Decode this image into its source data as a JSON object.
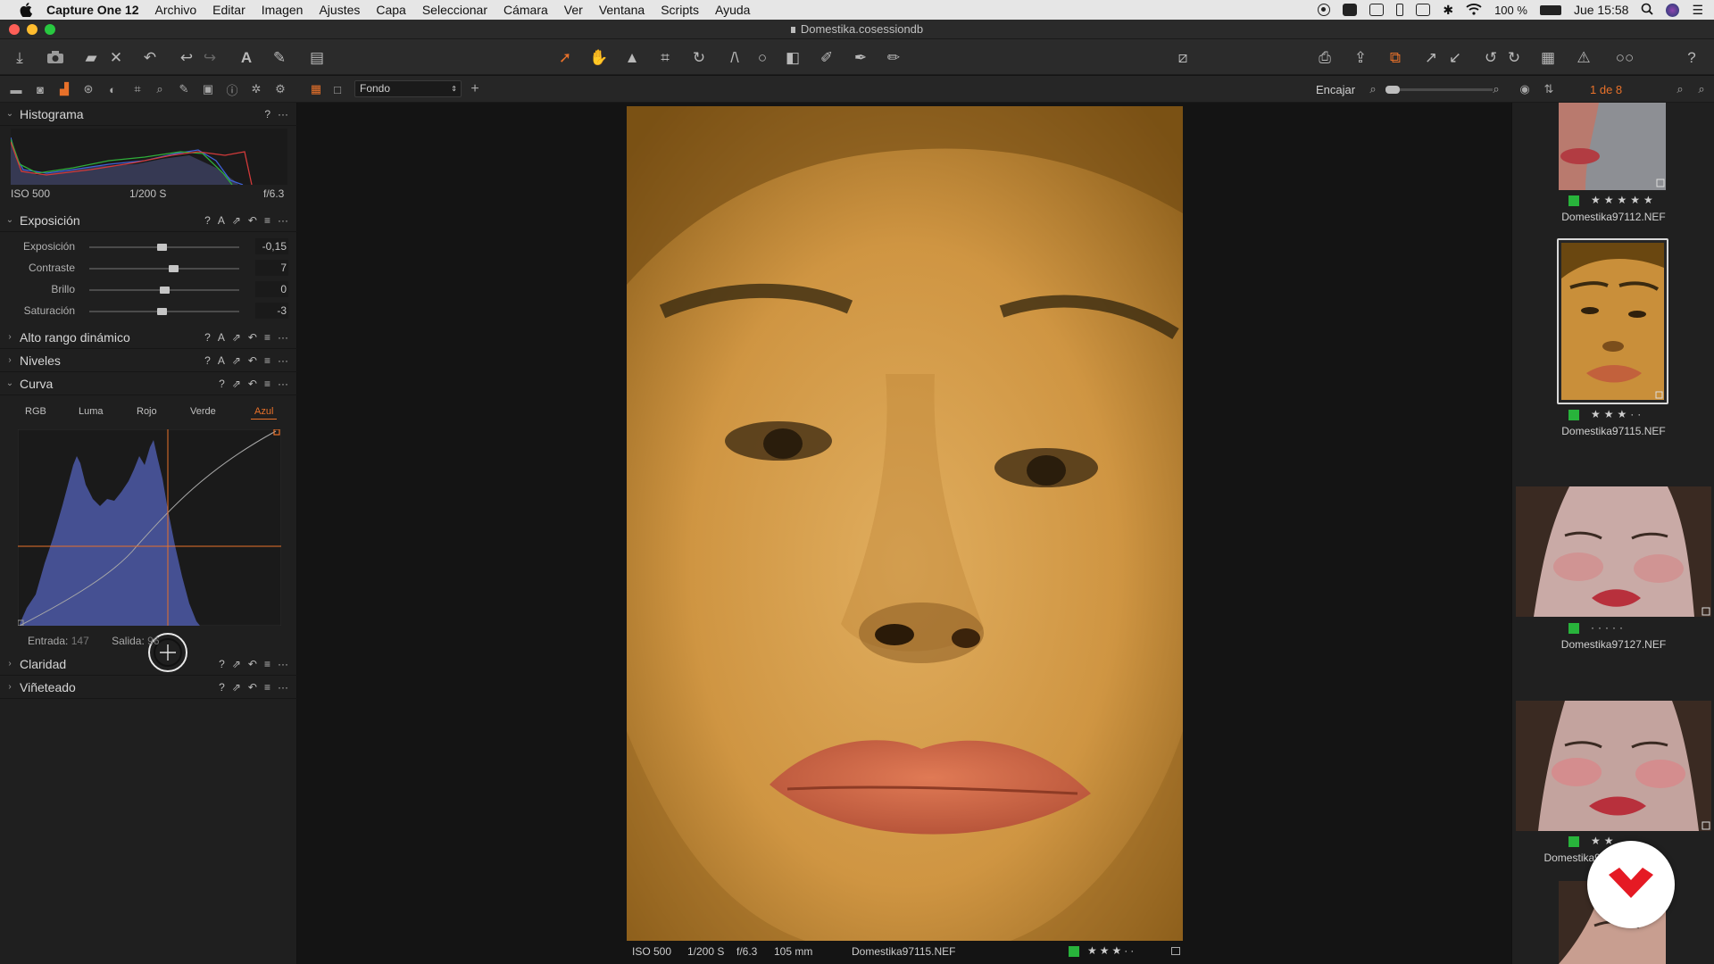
{
  "menubar": {
    "app_name": "Capture One 12",
    "items": [
      "Archivo",
      "Editar",
      "Imagen",
      "Ajustes",
      "Capa",
      "Seleccionar",
      "Cámara",
      "Ver",
      "Ventana",
      "Scripts",
      "Ayuda"
    ],
    "battery": "100 %",
    "clock": "Jue 15:58"
  },
  "window": {
    "title": "Domestika.cosessiondb"
  },
  "subbar": {
    "layer_select": "Fondo",
    "zoom_label": "Encajar",
    "count": "1 de 8"
  },
  "histogram": {
    "title": "Histograma",
    "iso": "ISO 500",
    "shutter": "1/200 S",
    "aperture": "f/6.3"
  },
  "exposure": {
    "title": "Exposición",
    "sliders": [
      {
        "label": "Exposición",
        "value": "-0,15",
        "level": -0.15
      },
      {
        "label": "Contraste",
        "value": "7",
        "level": 7
      },
      {
        "label": "Brillo",
        "value": "0",
        "level": 0
      },
      {
        "label": "Saturación",
        "value": "-3",
        "level": -3
      }
    ]
  },
  "sections": {
    "hdr": "Alto rango dinámico",
    "levels": "Niveles",
    "curve": "Curva",
    "clarity": "Claridad",
    "vignette": "Viñeteado"
  },
  "curve": {
    "tabs": [
      "RGB",
      "Luma",
      "Rojo",
      "Verde",
      "Azul"
    ],
    "active_tab": "Azul",
    "input_label": "Entrada:",
    "input_value": "147",
    "output_label": "Salida:",
    "output_value": "96"
  },
  "viewer": {
    "iso": "ISO 500",
    "shutter": "1/200 S",
    "aperture": "f/6.3",
    "focal": "105 mm",
    "filename": "Domestika97115.NEF",
    "rating": 3
  },
  "browser": {
    "thumbs": [
      {
        "name": "Domestika97112.NEF",
        "rating": 5
      },
      {
        "name": "Domestika97115.NEF",
        "rating": 3
      },
      {
        "name": "Domestika97127.NEF",
        "rating": 0
      },
      {
        "name": "Domestika97...",
        "rating": 2
      }
    ]
  },
  "colors": {
    "accent": "#e8712a",
    "green_tag": "#28b33b",
    "curve_blue": "#4e5aa8"
  }
}
